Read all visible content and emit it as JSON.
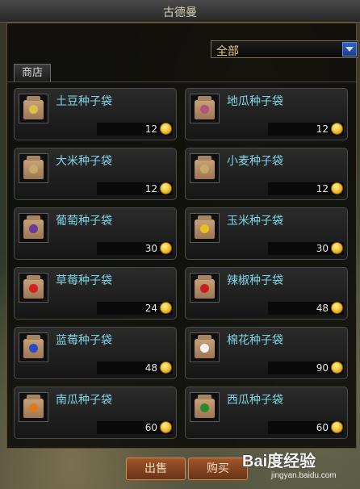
{
  "window": {
    "title": "古德曼"
  },
  "filter": {
    "selected": "全部"
  },
  "tabs": [
    {
      "label": "商店"
    }
  ],
  "items": [
    {
      "name": "土豆种子袋",
      "price": "12",
      "icon": "potato-seed-bag-icon",
      "seed_color": "#d8c04a"
    },
    {
      "name": "地瓜种子袋",
      "price": "12",
      "icon": "sweet-potato-seed-bag-icon",
      "seed_color": "#b0547a"
    },
    {
      "name": "大米种子袋",
      "price": "12",
      "icon": "rice-seed-bag-icon",
      "seed_color": "#c9a86a"
    },
    {
      "name": "小麦种子袋",
      "price": "12",
      "icon": "wheat-seed-bag-icon",
      "seed_color": "#c9a86a"
    },
    {
      "name": "葡萄种子袋",
      "price": "30",
      "icon": "grape-seed-bag-icon",
      "seed_color": "#6a3a9a"
    },
    {
      "name": "玉米种子袋",
      "price": "30",
      "icon": "corn-seed-bag-icon",
      "seed_color": "#e8c020"
    },
    {
      "name": "草莓种子袋",
      "price": "24",
      "icon": "strawberry-seed-bag-icon",
      "seed_color": "#d02020"
    },
    {
      "name": "辣椒种子袋",
      "price": "48",
      "icon": "chili-seed-bag-icon",
      "seed_color": "#c81e1e"
    },
    {
      "name": "蓝莓种子袋",
      "price": "48",
      "icon": "blueberry-seed-bag-icon",
      "seed_color": "#2a4ac8"
    },
    {
      "name": "棉花种子袋",
      "price": "90",
      "icon": "cotton-seed-bag-icon",
      "seed_color": "#f4f4f4"
    },
    {
      "name": "南瓜种子袋",
      "price": "60",
      "icon": "pumpkin-seed-bag-icon",
      "seed_color": "#e07a18"
    },
    {
      "name": "西瓜种子袋",
      "price": "60",
      "icon": "watermelon-seed-bag-icon",
      "seed_color": "#2a8a2a"
    }
  ],
  "buttons": {
    "sell": "出售",
    "buy": "购买"
  },
  "watermark": {
    "brand": "Bai度经验",
    "url": "jingyan.baidu.com"
  }
}
